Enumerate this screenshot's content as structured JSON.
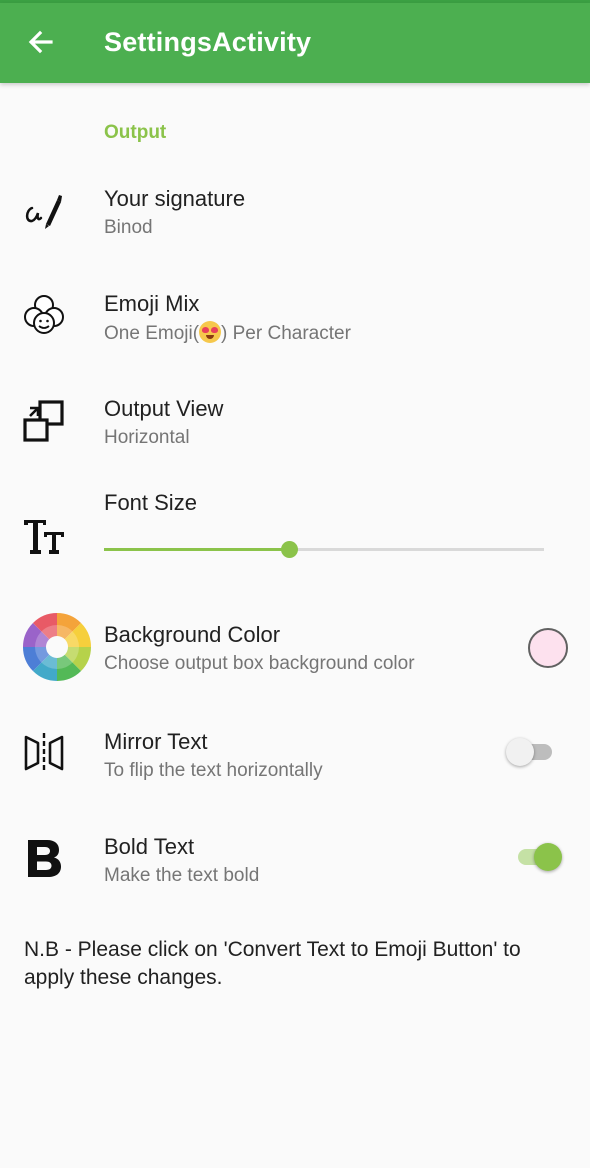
{
  "appbar": {
    "title": "SettingsActivity",
    "back_icon": "arrow-left-icon",
    "color": "#4caf50"
  },
  "category": {
    "label": "Output",
    "color": "#8bc34a"
  },
  "settings": {
    "signature": {
      "title": "Your signature",
      "summary": "Binod",
      "icon": "signature-pen-icon"
    },
    "emoji_mix": {
      "title": "Emoji Mix",
      "summary_before": "One Emoji(",
      "summary_after": ") Per Character",
      "icon": "emoji-faces-icon",
      "summary_emoji": "heart-eyes-emoji-icon"
    },
    "output_view": {
      "title": "Output View",
      "summary": "Horizontal",
      "icon": "output-view-icon"
    },
    "font_size": {
      "title": "Font Size",
      "icon": "text-size-icon",
      "slider_value_fraction": 0.42
    },
    "background_color": {
      "title": "Background Color",
      "summary": "Choose output box background color",
      "icon": "color-wheel-icon",
      "swatch_color": "#fde1ee"
    },
    "mirror_text": {
      "title": "Mirror Text",
      "summary": "To flip the text horizontally",
      "icon": "mirror-icon",
      "checked": false
    },
    "bold_text": {
      "title": "Bold Text",
      "summary": "Make the text bold",
      "icon": "bold-b-icon",
      "checked": true
    }
  },
  "note": "N.B - Please click on 'Convert Text to Emoji Button' to apply these changes."
}
